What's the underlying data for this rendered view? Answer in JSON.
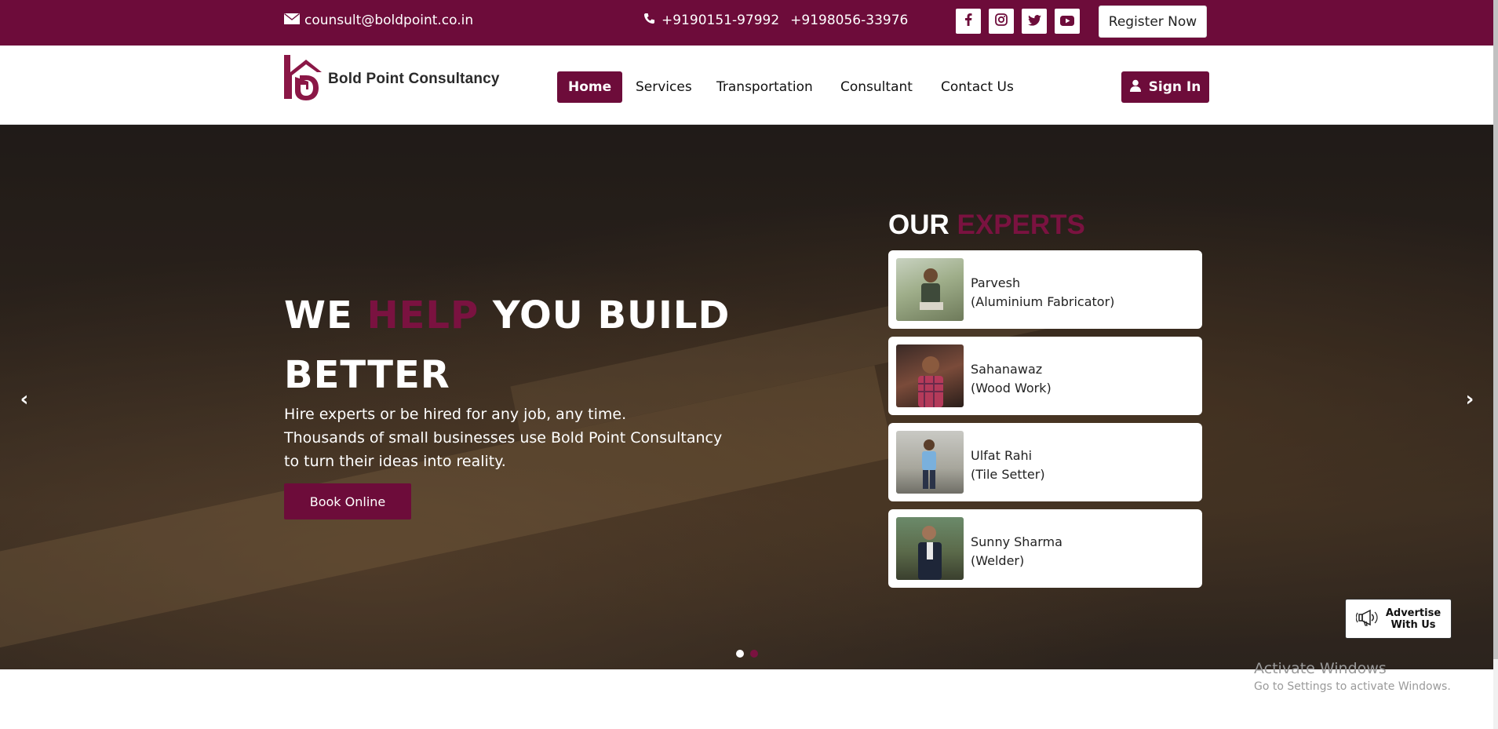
{
  "topbar": {
    "email": "counsult@boldpoint.co.in",
    "phone1": "+9190151-97992",
    "phone2": "+9198056-33976",
    "social": [
      {
        "icon": "facebook-icon",
        "glyph": "f"
      },
      {
        "icon": "instagram-icon",
        "glyph": ""
      },
      {
        "icon": "twitter-icon",
        "glyph": ""
      },
      {
        "icon": "youtube-icon",
        "glyph": ""
      }
    ],
    "register_label": "Register Now"
  },
  "brand": {
    "name": "Bold Point Consultancy",
    "accent_color": "#6d0c3a"
  },
  "nav": {
    "items": [
      {
        "label": "Home",
        "active": true
      },
      {
        "label": "Services",
        "active": false
      },
      {
        "label": "Transportation",
        "active": false
      },
      {
        "label": "Consultant",
        "active": false
      },
      {
        "label": "Contact Us",
        "active": false
      }
    ],
    "signin_label": "Sign In"
  },
  "hero": {
    "title_part1": "WE ",
    "title_accent": "HELP",
    "title_part2": " YOU BUILD BETTER",
    "subtitle_line1": "Hire experts or be hired for any job, any time.",
    "subtitle_line2": "Thousands of small businesses use Bold Point Consultancy",
    "subtitle_line3": "to turn their ideas into reality.",
    "cta_label": "Book Online",
    "prev_glyph": "‹",
    "next_glyph": "›"
  },
  "experts": {
    "title_part1": "OUR ",
    "title_accent": "EXPERTS",
    "items": [
      {
        "name": "Parvesh",
        "role": "(Aluminium Fabricator)"
      },
      {
        "name": "Sahanawaz",
        "role": "(Wood Work)"
      },
      {
        "name": "Ulfat Rahi",
        "role": "(Tile Setter)"
      },
      {
        "name": "Sunny Sharma",
        "role": "(Welder)"
      }
    ]
  },
  "slider": {
    "active_index": 0,
    "count": 2
  },
  "advertise": {
    "line1": "Advertise",
    "line2": "With Us"
  },
  "watermark": {
    "line1": "Activate Windows",
    "line2": "Go to Settings to activate Windows."
  }
}
